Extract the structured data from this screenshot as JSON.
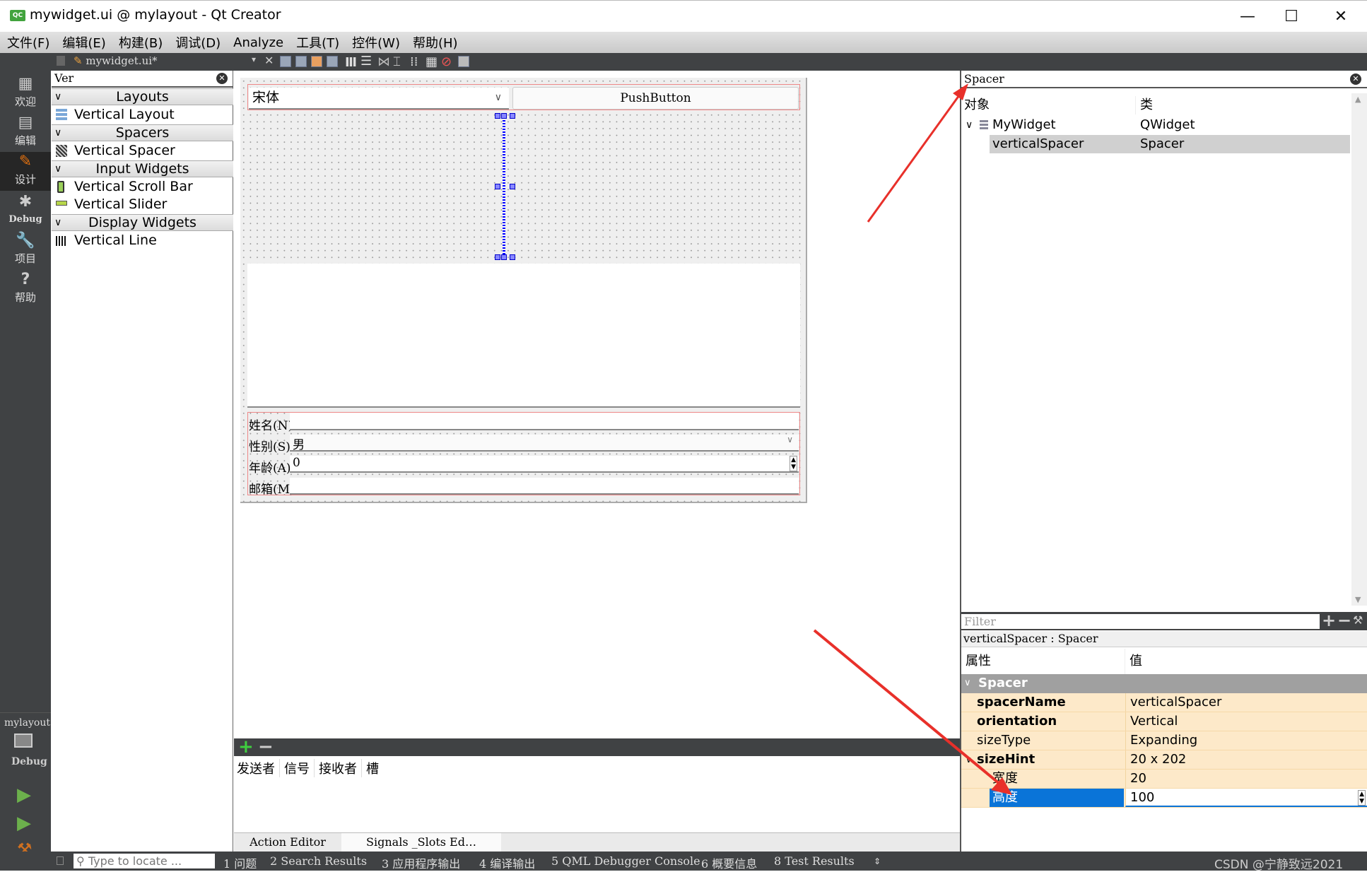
{
  "window": {
    "title": "mywidget.ui @ mylayout - Qt Creator",
    "app_badge": "QC",
    "minimize": "—",
    "maximize": "☐",
    "close": "✕"
  },
  "menu": [
    "文件(F)",
    "编辑(E)",
    "构建(B)",
    "调试(D)",
    "Analyze",
    "工具(T)",
    "控件(W)",
    "帮助(H)"
  ],
  "toolbar": {
    "file_name": "mywidget.ui*",
    "close": "✕"
  },
  "modes": [
    {
      "label": "欢迎",
      "icon": "▦"
    },
    {
      "label": "编辑",
      "icon": "▤"
    },
    {
      "label": "设计",
      "icon": "✎"
    },
    {
      "label": "Debug",
      "icon": "✱"
    },
    {
      "label": "项目",
      "icon": "🔧"
    },
    {
      "label": "帮助",
      "icon": "?"
    }
  ],
  "kit": {
    "project": "mylayout",
    "config": "Debug"
  },
  "widget_box": {
    "filter": "Ver",
    "categories": [
      {
        "name": "Layouts",
        "items": [
          "Vertical Layout"
        ]
      },
      {
        "name": "Spacers",
        "items": [
          "Vertical Spacer"
        ]
      },
      {
        "name": "Input Widgets",
        "items": [
          "Vertical Scroll Bar",
          "Vertical Slider"
        ]
      },
      {
        "name": "Display Widgets",
        "items": [
          "Vertical Line"
        ]
      }
    ]
  },
  "form": {
    "font_combo": "宋体",
    "push_button": "PushButton",
    "fields": [
      {
        "label": "姓名(N)",
        "value": ""
      },
      {
        "label": "性别(S)",
        "value": "男"
      },
      {
        "label": "年龄(A)",
        "value": "0"
      },
      {
        "label": "邮箱(M)",
        "value": ""
      }
    ]
  },
  "signals": {
    "columns": [
      "发送者",
      "信号",
      "接收者",
      "槽"
    ],
    "tabs": [
      "Action Editor",
      "Signals _Slots Ed…"
    ]
  },
  "object_inspector": {
    "filter": "Spacer",
    "columns": [
      "对象",
      "类"
    ],
    "rows": [
      {
        "object": "MyWidget",
        "class": "QWidget"
      },
      {
        "object": "verticalSpacer",
        "class": "Spacer"
      }
    ]
  },
  "property_editor": {
    "filter_placeholder": "Filter",
    "object_label": "verticalSpacer : Spacer",
    "columns": [
      "属性",
      "值"
    ],
    "group": "Spacer",
    "properties": [
      {
        "name": "spacerName",
        "value": "verticalSpacer"
      },
      {
        "name": "orientation",
        "value": "Vertical"
      },
      {
        "name": "sizeType",
        "value": "Expanding"
      },
      {
        "name": "sizeHint",
        "value": "20 x 202"
      },
      {
        "name": "宽度",
        "value": "20"
      },
      {
        "name": "高度",
        "value": "100"
      }
    ]
  },
  "status_bar": {
    "locate_placeholder": "Type to locate ...",
    "panes": [
      "1 问题",
      "2 Search Results",
      "3 应用程序输出",
      "4 编译输出",
      "5 QML Debugger Console",
      "6 概要信息",
      "8 Test Results"
    ],
    "watermark": "CSDN @宁静致远2021"
  },
  "colors": {
    "dark": "#404244",
    "selection": "#0a74d8",
    "property_bg": "#fde9c9"
  }
}
